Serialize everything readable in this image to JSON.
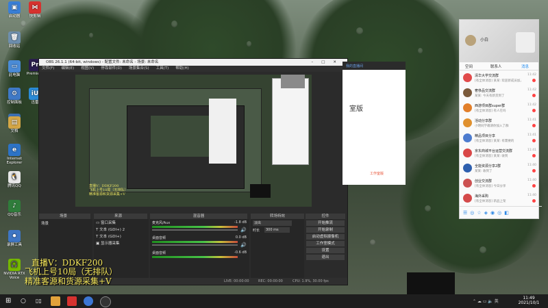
{
  "desktop": {
    "icons": [
      {
        "label": "此电脑",
        "color": "#4a8bd6",
        "glyph": "▭"
      },
      {
        "label": "回收站",
        "color": "#6e8fae",
        "glyph": "🗑"
      },
      {
        "label": "Premiere",
        "color": "#2a1d4d",
        "glyph": "Pr"
      },
      {
        "label": "控制面板",
        "color": "#3f79c6",
        "glyph": "⚙"
      },
      {
        "label": "网络",
        "color": "#3c6fb0",
        "glyph": "◎"
      },
      {
        "label": "迅雷",
        "color": "#2b8bd6",
        "glyph": "iU"
      },
      {
        "label": "文档",
        "color": "#d4a646",
        "glyph": "▤"
      },
      {
        "label": "Internet Explorer",
        "color": "#2d73c6",
        "glyph": "e"
      },
      {
        "label": "腾讯QQ",
        "color": "#e8e8e8",
        "glyph": "🐧"
      },
      {
        "label": "QQ音乐",
        "color": "#2f7d3b",
        "glyph": "♪"
      },
      {
        "label": "录屏工具",
        "color": "#3e76c4",
        "glyph": "⏺"
      },
      {
        "label": "NVIDIA RTX Voice",
        "color": "#76b900",
        "glyph": "🎧"
      }
    ],
    "top_icons": [
      {
        "label": "快剪辑",
        "color": "#d6322f",
        "glyph": "⋈"
      },
      {
        "label": "启动器",
        "color": "#3a7fd6",
        "glyph": "▣"
      }
    ],
    "overlay_lines": [
      "直播V：DDKF200",
      "飞机上号10局（无排队）",
      "精准客源和货源采集+V"
    ]
  },
  "obs": {
    "title": "OBS 26.1.1 (64-bit, windows) - 配置文件: 未命名 - 场景: 未命名",
    "menu": [
      "文件(F)",
      "编辑(E)",
      "视图(V)",
      "停靠部件(D)",
      "场景集合(S)",
      "工具(T)",
      "帮助(H)"
    ],
    "panels": {
      "scenes_header": "场景",
      "sources_header": "来源",
      "mixer_header": "混音器",
      "transitions_header": "转场特效",
      "controls_header": "控件"
    },
    "scene_item": "场景",
    "sources": [
      "窗口采集",
      "文本 (GDI+) 2",
      "文本 (GDI+)",
      "显示器采集"
    ],
    "mixer": [
      {
        "name": "麦克风/Aux",
        "db": "-1.8 dB"
      },
      {
        "name": "桌面音频",
        "db": "0.0 dB"
      },
      {
        "name": "桌面音频",
        "db": "-0.6 dB"
      }
    ],
    "transition": {
      "type": "淡出",
      "duration_label": "时长",
      "duration": "300 ms"
    },
    "controls": [
      "开始推流",
      "开始录制",
      "启动虚拟摄像机",
      "工作室模式",
      "设置",
      "退出"
    ],
    "status": {
      "live": "LIVE: 00:00:00",
      "rec": "REC: 00:00:00",
      "cpu": "CPU: 1.9%, 30.00 fps"
    }
  },
  "browser": {
    "top_link": "我的直播间",
    "heading": "室版",
    "footer_tab": "工作室版"
  },
  "qq": {
    "user": "小白",
    "tabs": [
      "空间",
      "联系人",
      "消息"
    ],
    "chats": [
      {
        "name": "清华大学交流群",
        "msg": "[有全体消息] 某某: 欢迎新成员加入",
        "time": "11:42",
        "color": "#e14b4b"
      },
      {
        "name": "奢侈品交流群",
        "msg": "某某: 今天有新货到了",
        "time": "11:42",
        "color": "#7b5a3b"
      },
      {
        "name": "西游项目群super群",
        "msg": "[有全体消息] 有人在吗",
        "time": "11:42",
        "color": "#e27f2a"
      },
      {
        "name": "活动分享群",
        "msg": "小明同学邀请你加入了群",
        "time": "11:41",
        "color": "#e0912f"
      },
      {
        "name": "精品项目分享",
        "msg": "[有全体消息] 某某: 有需要的",
        "time": "11:41",
        "color": "#4d7ccf"
      },
      {
        "name": "京东商城平台运营交流群",
        "msg": "[有全体消息] 某某: 收到",
        "time": "11:41",
        "color": "#d94848"
      },
      {
        "name": "全能资源分享2群",
        "msg": "某某: 收到了",
        "time": "11:40",
        "color": "#2e5fae"
      },
      {
        "name": "创业交流群",
        "msg": "[有全体消息] 今日分享",
        "time": "11:40",
        "color": "#cc5252"
      },
      {
        "name": "海外采购",
        "msg": "[有全体消息] 新品上架",
        "time": "11:40",
        "color": "#d44a4a"
      }
    ]
  },
  "taskbar": {
    "time": "11:49",
    "date": "2021/10/1"
  }
}
